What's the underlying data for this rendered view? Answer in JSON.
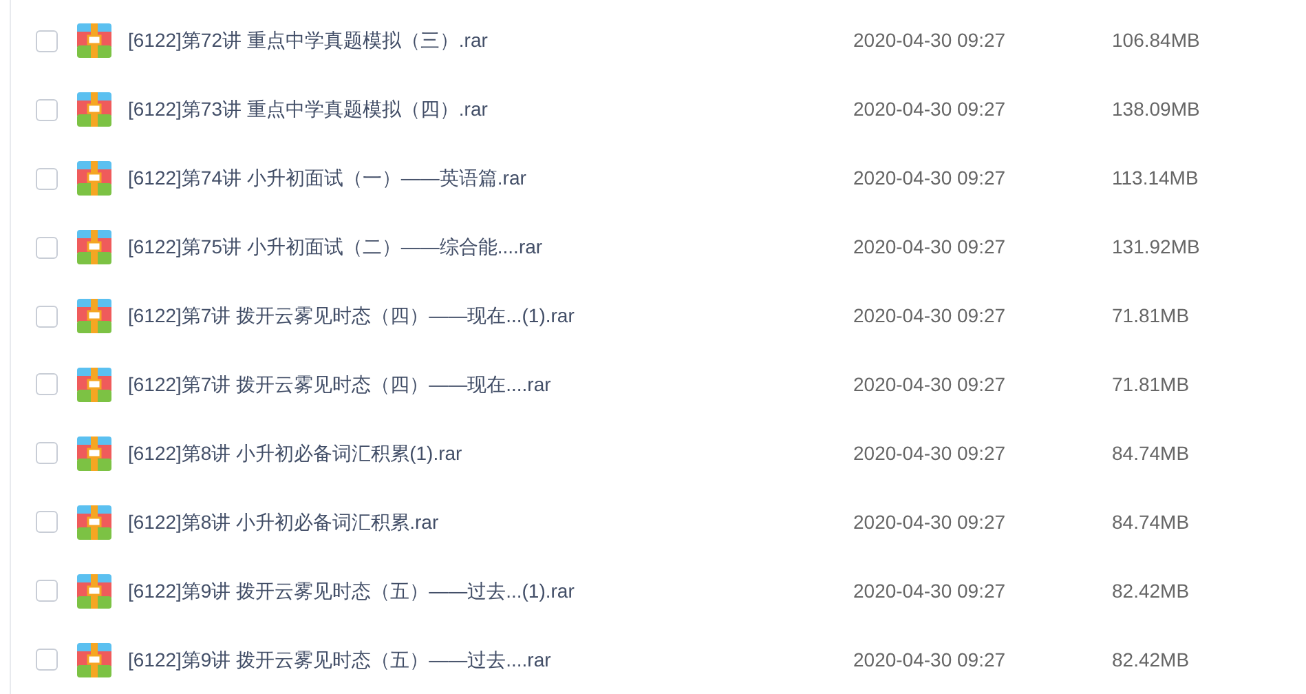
{
  "files": [
    {
      "checked": false,
      "name": "[6122]第72讲 重点中学真题模拟（三）.rar",
      "date": "2020-04-30 09:27",
      "size": "106.84MB"
    },
    {
      "checked": false,
      "name": "[6122]第73讲 重点中学真题模拟（四）.rar",
      "date": "2020-04-30 09:27",
      "size": "138.09MB"
    },
    {
      "checked": false,
      "name": "[6122]第74讲 小升初面试（一）——英语篇.rar",
      "date": "2020-04-30 09:27",
      "size": "113.14MB"
    },
    {
      "checked": false,
      "name": "[6122]第75讲 小升初面试（二）——综合能....rar",
      "date": "2020-04-30 09:27",
      "size": "131.92MB"
    },
    {
      "checked": false,
      "name": "[6122]第7讲 拨开云雾见时态（四）——现在...(1).rar",
      "date": "2020-04-30 09:27",
      "size": "71.81MB"
    },
    {
      "checked": false,
      "name": "[6122]第7讲 拨开云雾见时态（四）——现在....rar",
      "date": "2020-04-30 09:27",
      "size": "71.81MB"
    },
    {
      "checked": false,
      "name": "[6122]第8讲 小升初必备词汇积累(1).rar",
      "date": "2020-04-30 09:27",
      "size": "84.74MB"
    },
    {
      "checked": false,
      "name": "[6122]第8讲 小升初必备词汇积累.rar",
      "date": "2020-04-30 09:27",
      "size": "84.74MB"
    },
    {
      "checked": false,
      "name": "[6122]第9讲 拨开云雾见时态（五）——过去...(1).rar",
      "date": "2020-04-30 09:27",
      "size": "82.42MB"
    },
    {
      "checked": false,
      "name": "[6122]第9讲 拨开云雾见时态（五）——过去....rar",
      "date": "2020-04-30 09:27",
      "size": "82.42MB"
    }
  ]
}
